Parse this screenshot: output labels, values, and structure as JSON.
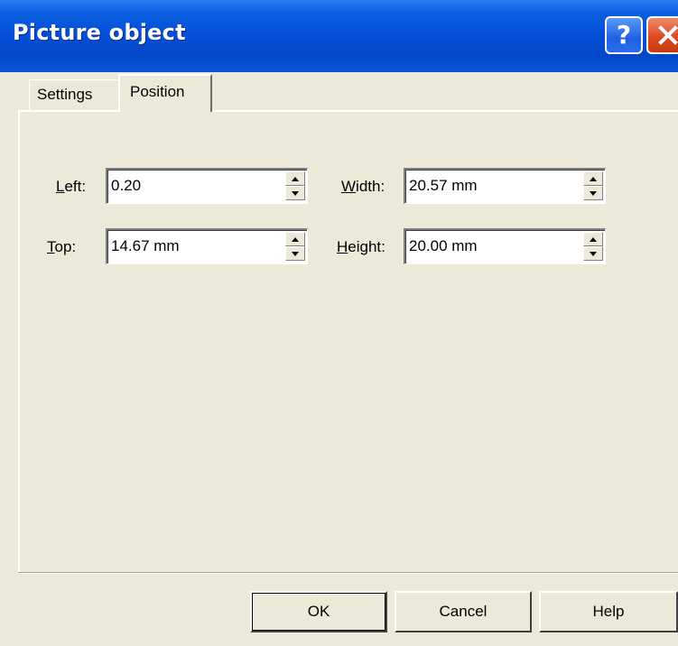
{
  "window": {
    "title": "Picture object",
    "help_icon": "?",
    "close_icon": "close-x"
  },
  "tabs": [
    {
      "label": "Settings",
      "selected": false
    },
    {
      "label": "Position",
      "selected": true
    }
  ],
  "fields": {
    "left": {
      "label_accel": "L",
      "label_rest": "eft:",
      "value": "0.20"
    },
    "top": {
      "label_accel": "T",
      "label_rest": "op:",
      "value": "14.67 mm"
    },
    "width": {
      "label_accel": "W",
      "label_rest": "idth:",
      "value": "20.57 mm"
    },
    "height": {
      "label_accel": "H",
      "label_rest": "eight:",
      "value": "20.00 mm"
    }
  },
  "buttons": {
    "ok": "OK",
    "cancel": "Cancel",
    "help": "Help"
  },
  "colors": {
    "title_bar": "#0550d9",
    "close_button": "#dd4b22",
    "dialog_face": "#ece9d8"
  }
}
